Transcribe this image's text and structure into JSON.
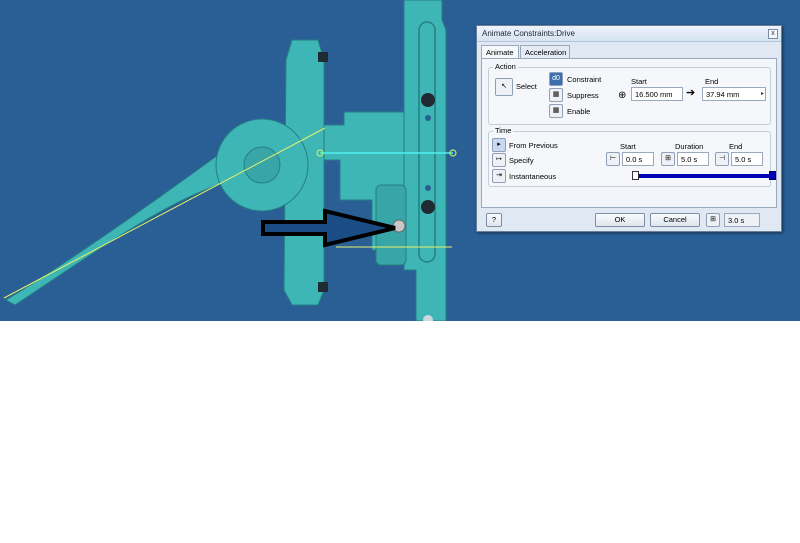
{
  "dialog": {
    "title": "Animate Constraints:Drive",
    "close_glyph": "x",
    "tabs": [
      {
        "label": "Animate",
        "active": true
      },
      {
        "label": "Acceleration",
        "active": false
      }
    ],
    "action": {
      "group_label": "Action",
      "select_label": "Select",
      "constraint_icon_text": "d0",
      "constraint_label": "Constraint",
      "suppress_label": "Suppress",
      "enable_label": "Enable",
      "start_header": "Start",
      "end_header": "End",
      "start_value": "16.500 mm",
      "end_value": "37.94 mm",
      "spin_glyph": "▸",
      "arrow_glyph": "➔"
    },
    "time": {
      "group_label": "Time",
      "from_previous_label": "From Previous",
      "specify_label": "Specify",
      "instantaneous_label": "Instantaneous",
      "start_header": "Start",
      "duration_header": "Duration",
      "end_header": "End",
      "start_value": "0.0 s",
      "duration_value": "5.0 s",
      "end_value": "5.0 s",
      "slider_fraction": 1.0
    },
    "footer": {
      "ok_label": "OK",
      "cancel_label": "Cancel",
      "help_glyph": "?",
      "playback_value": "3.0 s"
    }
  },
  "colors": {
    "viewport_bg": "#2a5f96",
    "part_color": "#3fb6b6",
    "slider_color": "#0000b4"
  }
}
